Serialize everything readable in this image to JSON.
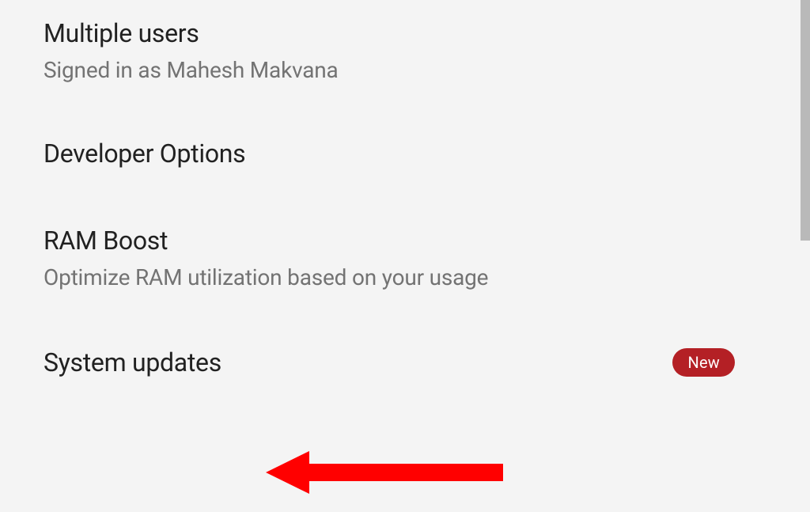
{
  "settings": [
    {
      "title": "Multiple users",
      "subtitle": "Signed in as Mahesh Makvana"
    },
    {
      "title": "Developer Options",
      "subtitle": null
    },
    {
      "title": "RAM Boost",
      "subtitle": "Optimize RAM utilization based on your usage"
    },
    {
      "title": "System updates",
      "subtitle": null,
      "badge": "New"
    }
  ],
  "colors": {
    "badge": "#b42025",
    "annotation": "#ff0000"
  }
}
